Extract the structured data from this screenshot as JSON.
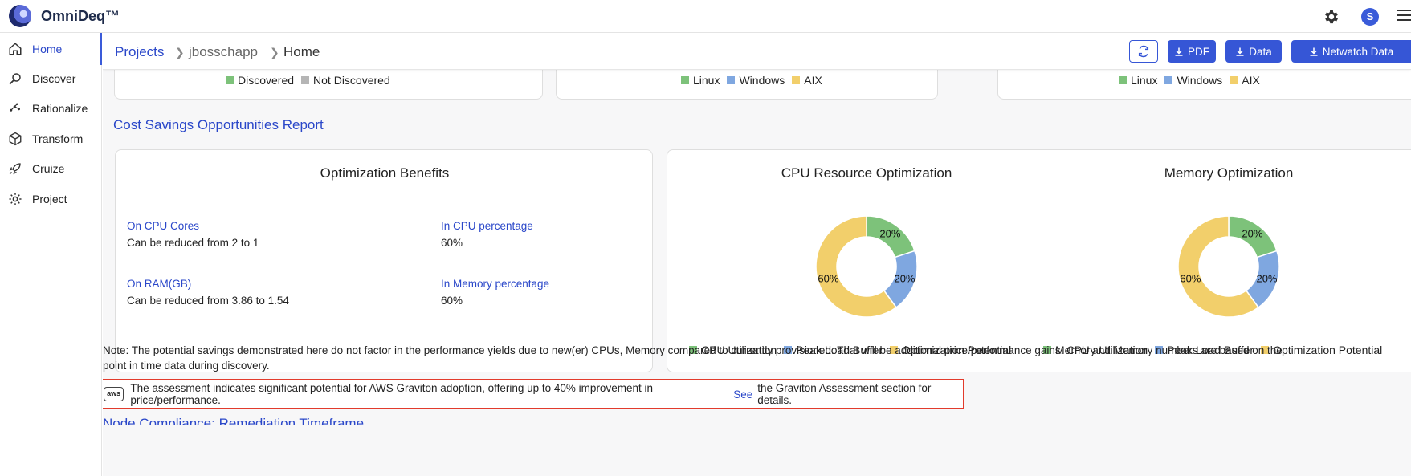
{
  "app": {
    "title": "OmniDeq™",
    "user_initial": "S"
  },
  "sidebar": {
    "items": [
      {
        "label": "Home",
        "icon": "home-icon",
        "active": true
      },
      {
        "label": "Discover",
        "icon": "discover-icon"
      },
      {
        "label": "Rationalize",
        "icon": "rationalize-icon"
      },
      {
        "label": "Transform",
        "icon": "cube-icon"
      },
      {
        "label": "Cruize",
        "icon": "rocket-icon"
      },
      {
        "label": "Project",
        "icon": "gear-icon"
      }
    ]
  },
  "breadcrumb": {
    "projects": "Projects",
    "project": "jbosschapp",
    "current": "Home"
  },
  "toolbar": {
    "pdf": "PDF",
    "data": "Data",
    "netwatch": "Netwatch Data"
  },
  "top_cards": [
    {
      "legend": [
        {
          "label": "Discovered",
          "color": "#7dc27a"
        },
        {
          "label": "Not Discovered",
          "color": "#b5b5b5"
        }
      ]
    },
    {
      "legend": [
        {
          "label": "Linux",
          "color": "#7dc27a"
        },
        {
          "label": "Windows",
          "color": "#7fa7e0"
        },
        {
          "label": "AIX",
          "color": "#f2cf6b"
        }
      ]
    },
    {
      "legend": [
        {
          "label": "Linux",
          "color": "#7dc27a"
        },
        {
          "label": "Windows",
          "color": "#7fa7e0"
        },
        {
          "label": "AIX",
          "color": "#f2cf6b"
        }
      ]
    }
  ],
  "section_title": "Cost Savings Opportunities Report",
  "benefits": {
    "title": "Optimization Benefits",
    "cpu_cores_label": "On CPU Cores",
    "cpu_cores_value": "Can be reduced from 2 to 1",
    "cpu_pct_label": "In CPU percentage",
    "cpu_pct_value": "60%",
    "ram_label": "On RAM(GB)",
    "ram_value": "Can be reduced from 3.86 to 1.54",
    "mem_pct_label": "In Memory percentage",
    "mem_pct_value": "60%"
  },
  "chart_data": [
    {
      "type": "pie",
      "title": "CPU Resource Optimization",
      "categories": [
        "CPU Utilization",
        "Peak Load Buffer",
        "Optimization Potential"
      ],
      "values": [
        20,
        20,
        60
      ],
      "labels": [
        "20%",
        "20%",
        "60%"
      ],
      "colors": [
        "#7dc27a",
        "#7fa7e0",
        "#f2cf6b"
      ],
      "legend_position": "bottom"
    },
    {
      "type": "pie",
      "title": "Memory Optimization",
      "categories": [
        "Memory Utilization",
        "Peak Load Buffer",
        "Optimization Potential"
      ],
      "values": [
        20,
        20,
        60
      ],
      "labels": [
        "20%",
        "20%",
        "60%"
      ],
      "colors": [
        "#7dc27a",
        "#7fa7e0",
        "#f2cf6b"
      ],
      "legend_position": "bottom"
    }
  ],
  "note": "Note: The potential savings demonstrated here do not factor in the performance yields due to new(er) CPUs, Memory compared to currently provisioned. That will be additional price/performance gains. CPU and Memory numbers are based on the point in time data during discovery.",
  "aws_banner": {
    "logo_text": "aws",
    "text_before": "The assessment indicates significant potential for AWS Graviton adoption, offering up to 40% improvement in price/performance.",
    "link": "See",
    "text_after": "the Graviton Assessment section for details."
  },
  "cut_section_title": "Node Compliance: Remediation Timeframe"
}
